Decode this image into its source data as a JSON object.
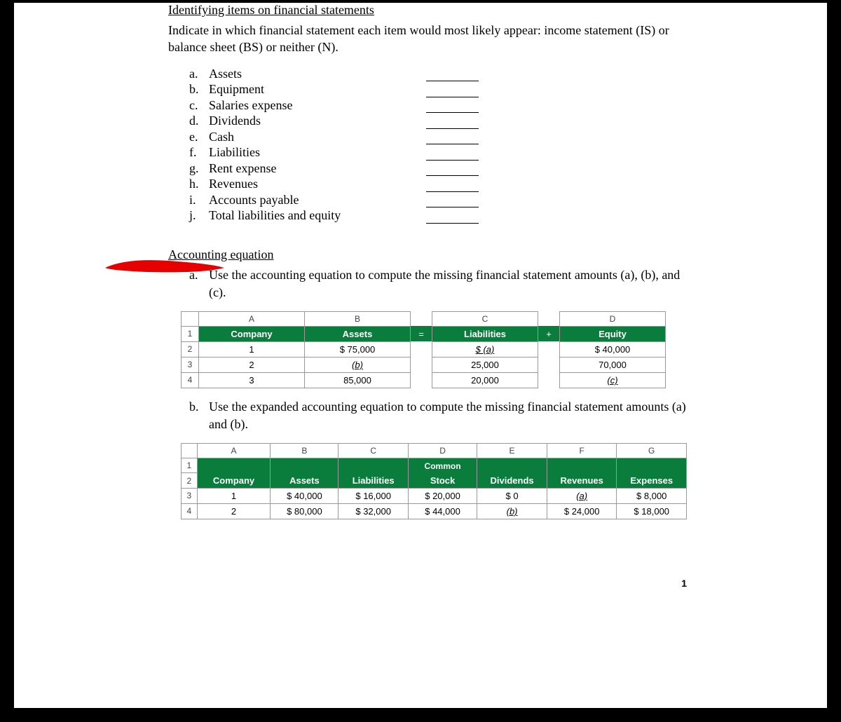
{
  "section1": {
    "title": "Identifying items on financial statements",
    "instruction": "Indicate in which financial statement each item would most likely appear:  income statement (IS) or balance sheet (BS) or neither (N).",
    "items": [
      {
        "marker": "a.",
        "label": "Assets"
      },
      {
        "marker": "b.",
        "label": "Equipment"
      },
      {
        "marker": "c.",
        "label": "Salaries expense"
      },
      {
        "marker": "d.",
        "label": "Dividends"
      },
      {
        "marker": "e.",
        "label": "Cash"
      },
      {
        "marker": "f.",
        "label": "Liabilities"
      },
      {
        "marker": "g.",
        "label": "Rent expense"
      },
      {
        "marker": "h.",
        "label": "Revenues"
      },
      {
        "marker": "i.",
        "label": "Accounts payable"
      },
      {
        "marker": "j.",
        "label": "Total liabilities and equity"
      }
    ]
  },
  "section2": {
    "title": "Accounting equation",
    "part_a": {
      "marker": "a.",
      "text": "Use the accounting equation to compute the missing financial statement amounts (a), (b), and (c)."
    },
    "part_b": {
      "marker": "b.",
      "text": "Use the expanded accounting equation to compute the missing financial statement amounts (a) and (b)."
    }
  },
  "table1": {
    "col_letters": [
      "A",
      "B",
      "C",
      "D"
    ],
    "headers": {
      "company": "Company",
      "assets": "Assets",
      "eq": "=",
      "liab": "Liabilities",
      "plus": "+",
      "equity": "Equity"
    },
    "rows": [
      {
        "num": "2",
        "company": "1",
        "assets": "$ 75,000",
        "liab": "$     (a)",
        "liab_ital": true,
        "equity": "$ 40,000"
      },
      {
        "num": "3",
        "company": "2",
        "assets": "(b)",
        "assets_ital": true,
        "liab": "25,000",
        "equity": "70,000"
      },
      {
        "num": "4",
        "company": "3",
        "assets": "85,000",
        "liab": "20,000",
        "equity": "(c)",
        "equity_ital": true
      }
    ]
  },
  "table2": {
    "col_letters": [
      "A",
      "B",
      "C",
      "D",
      "E",
      "F",
      "G"
    ],
    "headers": {
      "company": "Company",
      "assets": "Assets",
      "liab": "Liabilities",
      "common_top": "Common",
      "stock": "Stock",
      "div": "Dividends",
      "rev": "Revenues",
      "exp": "Expenses"
    },
    "rows": [
      {
        "num": "3",
        "company": "1",
        "assets": "$ 40,000",
        "liab": "$ 16,000",
        "stock": "$ 20,000",
        "div": "$ 0",
        "rev": "(a)",
        "rev_ital": true,
        "exp": "$  8,000"
      },
      {
        "num": "4",
        "company": "2",
        "assets": "$ 80,000",
        "liab": "$ 32,000",
        "stock": "$ 44,000",
        "div": "(b)",
        "div_ital": true,
        "rev": "$ 24,000",
        "exp": "$ 18,000"
      }
    ]
  },
  "page_number": "1",
  "chart_data": [
    {
      "type": "table",
      "title": "Accounting equation",
      "columns": [
        "Company",
        "Assets",
        "Liabilities",
        "Equity"
      ],
      "rows": [
        [
          "1",
          "$ 75,000",
          "(a)",
          "$ 40,000"
        ],
        [
          "2",
          "(b)",
          "25,000",
          "70,000"
        ],
        [
          "3",
          "85,000",
          "20,000",
          "(c)"
        ]
      ]
    },
    {
      "type": "table",
      "title": "Expanded accounting equation",
      "columns": [
        "Company",
        "Assets",
        "Liabilities",
        "Common Stock",
        "Dividends",
        "Revenues",
        "Expenses"
      ],
      "rows": [
        [
          "1",
          "$ 40,000",
          "$ 16,000",
          "$ 20,000",
          "$ 0",
          "(a)",
          "$ 8,000"
        ],
        [
          "2",
          "$ 80,000",
          "$ 32,000",
          "$ 44,000",
          "(b)",
          "$ 24,000",
          "$ 18,000"
        ]
      ]
    }
  ]
}
